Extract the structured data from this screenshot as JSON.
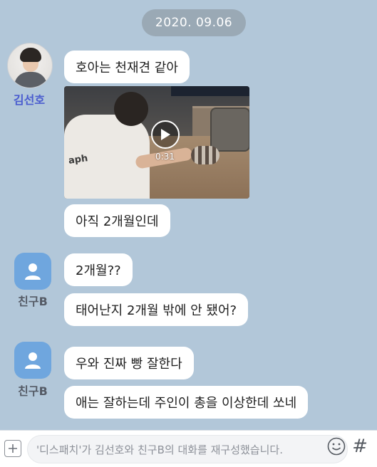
{
  "date_label": "2020. 09.06",
  "messages": [
    {
      "sender": "김선호",
      "text": "호아는 천재견 같아"
    },
    {
      "sender": "김선호",
      "video_duration": "0:31",
      "video_shirt_text": "aph"
    },
    {
      "sender": "김선호",
      "text": "아직 2개월인데"
    },
    {
      "sender": "친구B",
      "text": "2개월??"
    },
    {
      "sender": "친구B",
      "text": "태어난지 2개월 밖에 안 됐어?"
    },
    {
      "sender": "친구B",
      "text": "우와 진짜 빵 잘한다"
    },
    {
      "sender": "친구B",
      "text": "애는 잘하는데 주인이 총을 이상한데 쏘네"
    }
  ],
  "senders": {
    "first": {
      "name": "김선호",
      "avatar": "profile-photo",
      "name_color": "#4a5ccf"
    },
    "second": {
      "name": "친구B",
      "avatar": "default-person-icon",
      "avatar_color": "#6fa6de"
    }
  },
  "input_bar": {
    "placeholder": "'디스패치'가 김선호와 친구B의 대화를 재구성했습니다.",
    "plus_icon": "plus-icon",
    "emoji_icon": "smile-icon",
    "hash_label": "#"
  },
  "colors": {
    "background": "#b2c7d9",
    "bubble": "#ffffff",
    "date_pill": "#9aa9b5"
  }
}
